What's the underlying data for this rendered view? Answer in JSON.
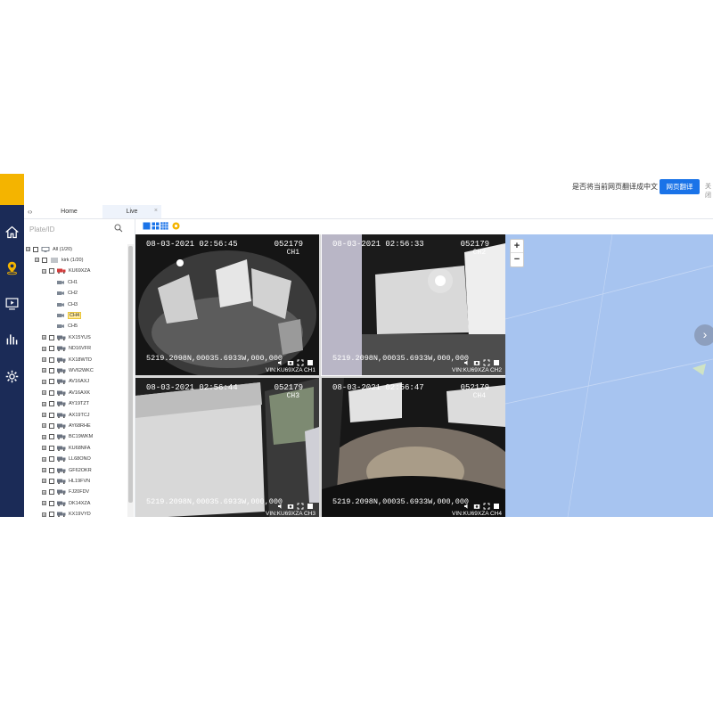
{
  "translate_bar": {
    "prompt": "是否将当前网页翻译成中文",
    "button_label": "网页翻译",
    "more_label": "关闭"
  },
  "tabs": {
    "collapse_icon": "‹›",
    "home": "Home",
    "live": "Live",
    "close": "×"
  },
  "search": {
    "placeholder": "Plate/ID"
  },
  "tree": {
    "root": "All (1/20)",
    "group": "kirk (1/20)",
    "vehicle": "KU69XZA",
    "channels": [
      "CH1",
      "CH2",
      "CH3",
      "CH4",
      "CH5"
    ],
    "selected_channel": "CH4",
    "other_vehicles": [
      "KX15YUS",
      "ND16VFR",
      "KX18WTD",
      "WV62WKC",
      "AV16AXJ",
      "AV16AXK",
      "AY19TZT",
      "AX19TCJ",
      "AY68RHE",
      "BC19WKM",
      "KU68NFA",
      "LL68ONO",
      "GF62OKR",
      "HL19FVN",
      "FJ20FDV",
      "DK14XZA",
      "KX19VYD"
    ]
  },
  "video_grid": {
    "cells": [
      {
        "timestamp": "08-03-2021 02:56:45",
        "device": "052179",
        "channel": "CH1",
        "gps": "5219.2098N,00035.6933W,000,000",
        "vin": "VIN:KU69XZA CH1"
      },
      {
        "timestamp": "08-03-2021 02:56:33",
        "device": "052179",
        "channel": "CH2",
        "gps": "5219.2098N,00035.6933W,000,000",
        "vin": "VIN:KU69XZA CH2"
      },
      {
        "timestamp": "08-03-2021 02:56:44",
        "device": "052179",
        "channel": "CH3",
        "gps": "5219.2098N,00035.6933W,000,000",
        "vin": "VIN:KU69XZA CH3"
      },
      {
        "timestamp": "08-03-2021 02:56:47",
        "device": "052179",
        "channel": "CH4",
        "gps": "5219.2098N,00035.6933W,000,000",
        "vin": "VIN:KU69XZA CH4"
      }
    ]
  },
  "map": {
    "zoom_in": "+",
    "zoom_out": "−",
    "next_arrow": "›"
  },
  "colors": {
    "rail": "#1b2b57",
    "logo": "#f4b400",
    "accent": "#1a73e8",
    "map_water": "#a7c4f0",
    "selected": "#ffe99a"
  },
  "icons": {
    "nav": [
      "home-icon",
      "location-pin-icon",
      "monitor-icon",
      "bar-chart-icon",
      "gear-icon"
    ]
  }
}
